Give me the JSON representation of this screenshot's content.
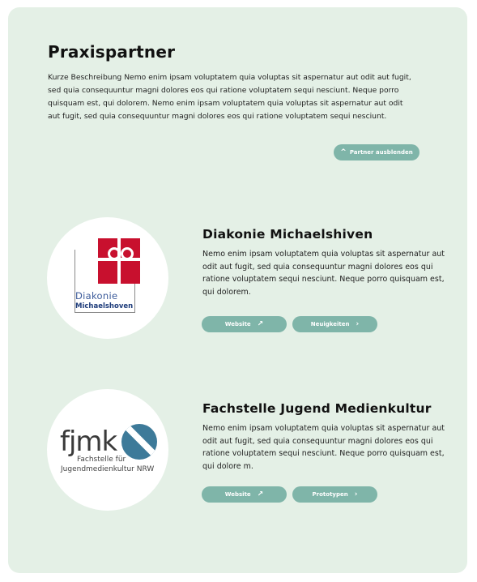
{
  "section": {
    "title": "Praxispartner",
    "description": "Kurze Beschreibung Nemo enim ipsam voluptatem quia voluptas sit aspernatur aut odit aut fugit, sed quia consequuntur magni dolores eos qui ratione voluptatem sequi nesciunt. Neque porro quisquam est, qui dolorem. Nemo enim ipsam voluptatem quia voluptas sit aspernatur aut odit aut fugit, sed quia consequuntur magni dolores eos qui ratione voluptatem sequi nesciunt.",
    "toggle_label": "Partner ausblenden",
    "toggle_icon": "^"
  },
  "partners": [
    {
      "name": "Diakonie Michaelshiven",
      "description": "Nemo enim ipsam voluptatem quia voluptas sit aspernatur aut odit aut fugit, sed quia consequuntur magni dolores eos qui ratione voluptatem sequi nesciunt. Neque porro quisquam est, qui dolorem.",
      "button_a": "Website",
      "button_a_icon": "↗",
      "button_b": "Neuigkeiten",
      "button_b_icon": "›",
      "logo_line1": "Diakonie",
      "logo_line2": "Michaelshoven"
    },
    {
      "name": "Fachstelle Jugend Medienkultur",
      "description": "Nemo enim ipsam voluptatem quia voluptas sit aspernatur aut odit aut fugit, sed quia consequuntur magni dolores eos qui ratione voluptatem sequi nesciunt. Neque porro quisquam est, qui dolore m.",
      "button_a": "Website",
      "button_a_icon": "↗",
      "button_b": "Prototypen",
      "button_b_icon": "›",
      "logo_mark": "fjmk",
      "logo_line1": "Fachstelle für",
      "logo_line2": "Jugendmedienkultur NRW"
    }
  ],
  "colors": {
    "background": "#e4f0e6",
    "button": "#7fb5a9",
    "diakonie_red": "#c8102e",
    "fjmk_blue": "#3d7a99"
  }
}
